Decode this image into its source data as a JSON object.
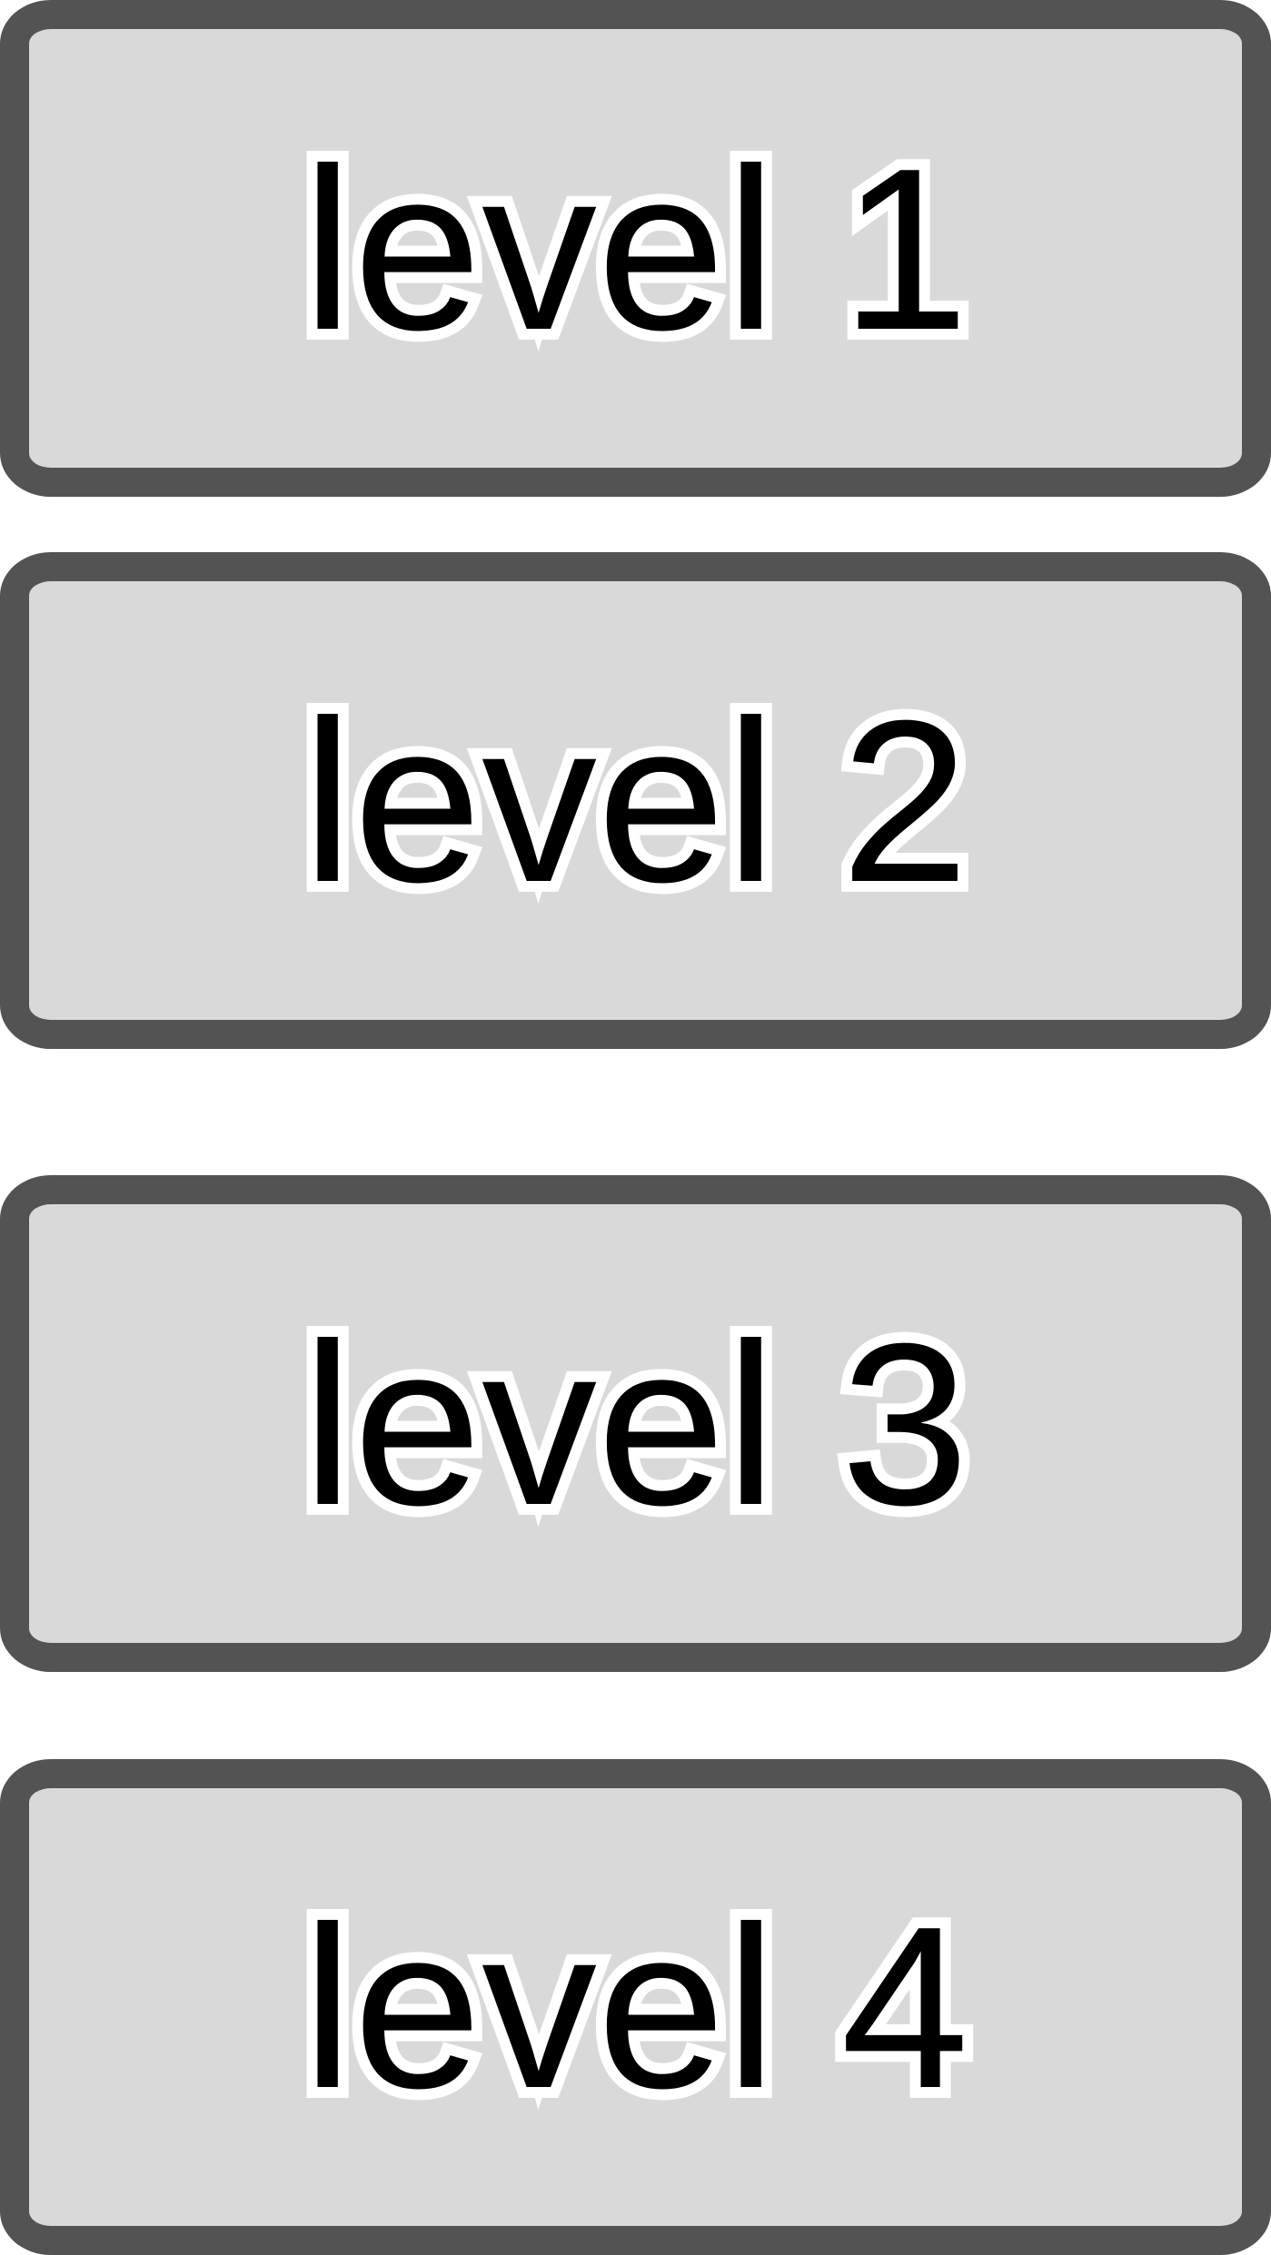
{
  "levels": [
    {
      "label": "level 1"
    },
    {
      "label": "level 2"
    },
    {
      "label": "level 3"
    },
    {
      "label": "level 4"
    }
  ],
  "colors": {
    "background": "#ffffff",
    "button_fill": "#d9d9d9",
    "button_border": "#535353",
    "text_fill": "#000000",
    "text_outline": "#ffffff"
  }
}
